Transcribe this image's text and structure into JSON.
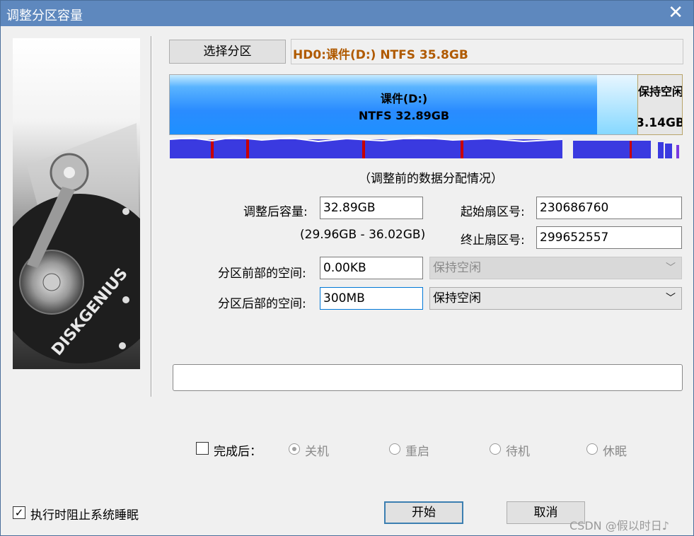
{
  "window": {
    "title": "调整分区容量",
    "close_label": "✕"
  },
  "brand": {
    "logo_text": "DISKGENIUS"
  },
  "partition": {
    "select_button": "选择分区",
    "info": "HD0:课件(D:) NTFS 35.8GB",
    "bar_label_line1": "课件(D:)",
    "bar_label_line2": "NTFS 32.89GB",
    "free_label_line1": "保持空闲",
    "free_label_line2": "3.14GB",
    "map_caption": "（调整前的数据分配情况）"
  },
  "form": {
    "new_size_label": "调整后容量:",
    "new_size_value": "32.89GB",
    "range_text": "(29.96GB - 36.02GB)",
    "start_sector_label": "起始扇区号:",
    "start_sector_value": "230686760",
    "end_sector_label": "终止扇区号:",
    "end_sector_value": "299652557",
    "before_label": "分区前部的空间:",
    "before_value": "0.00KB",
    "before_option": "保持空闲",
    "after_label": "分区后部的空间:",
    "after_value": "300MB",
    "after_option": "保持空闲"
  },
  "after_completion": {
    "checkbox_label": "完成后：",
    "checked": false,
    "options": [
      "关机",
      "重启",
      "待机",
      "休眠"
    ],
    "selected": "关机"
  },
  "footer": {
    "prevent_sleep_label": "执行时阻止系统睡眠",
    "prevent_sleep_checked": true,
    "start_button": "开始",
    "cancel_button": "取消"
  },
  "watermark": "CSDN @假以时日♪",
  "colors": {
    "titlebar": "#5e88be",
    "partition_blue": "#1e90ff",
    "map_blue": "#3a3ae0",
    "map_red": "#c80000",
    "info_text": "#b05a00"
  }
}
